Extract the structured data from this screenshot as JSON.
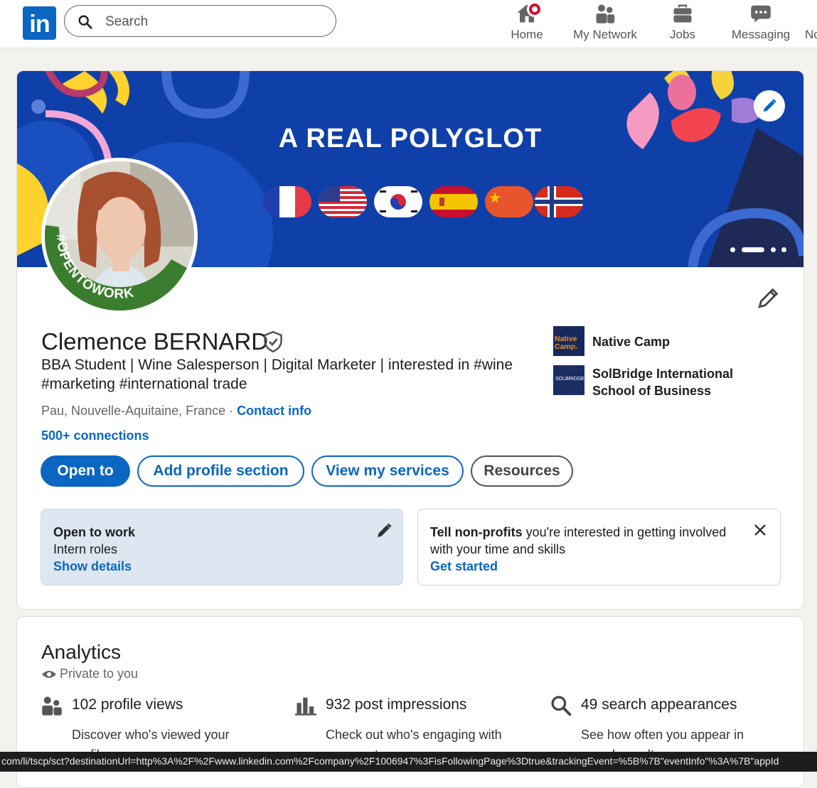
{
  "nav": {
    "logo_text": "in",
    "search_placeholder": "Search",
    "items": [
      {
        "label": "Home"
      },
      {
        "label": "My Network"
      },
      {
        "label": "Jobs"
      },
      {
        "label": "Messaging"
      },
      {
        "label": "No"
      }
    ]
  },
  "banner": {
    "title": "A REAL POLYGLOT",
    "flags": [
      "france-flag",
      "usa-flag",
      "south-korea-flag",
      "spain-flag",
      "china-flag",
      "norway-flag"
    ]
  },
  "profile": {
    "avatar_frame_text": "#OPENTOWORK",
    "name": "Clemence BERNARD",
    "headline": "BBA Student | Wine Salesperson | Digital Marketer | interested in #wine #marketing #international trade",
    "location": "Pau, Nouvelle-Aquitaine, France",
    "separator": " · ",
    "contact_info": "Contact info",
    "connections": "500+ connections",
    "organizations": [
      {
        "name": "Native Camp",
        "logo_text": "Native Camp."
      },
      {
        "name": "SolBridge International School of Business",
        "logo_text": "SOLBRIDGE"
      }
    ],
    "buttons": {
      "open_to": "Open to",
      "add_section": "Add profile section",
      "services": "View my services",
      "resources": "Resources"
    },
    "open_to_work": {
      "title": "Open to work",
      "roles": "Intern roles",
      "link": "Show details"
    },
    "nonprofits": {
      "bold": "Tell non-profits",
      "text": " you're interested in getting involved with your time and skills",
      "link": "Get started"
    }
  },
  "analytics": {
    "title": "Analytics",
    "visibility": "Private to you",
    "stats": [
      {
        "title": "102 profile views",
        "desc": "Discover who's viewed your profile."
      },
      {
        "title": "932 post impressions",
        "desc": "Check out who's engaging with your posts."
      },
      {
        "title": "49 search appearances",
        "desc": "See how often you appear in search results."
      }
    ]
  },
  "status_bar": {
    "url": "com/li/tscp/sct?destinationUrl=http%3A%2F%2Fwww.linkedin.com%2Fcompany%2F1006947%3FisFollowingPage%3Dtrue&trackingEvent=%5B%7B\"eventInfo\"%3A%7B\"appId"
  },
  "colors": {
    "brand": "#0a66c2",
    "banner": "#0f3fa8",
    "open_to_work_ring": "#3a7d2e",
    "badge": "#cb112d"
  }
}
